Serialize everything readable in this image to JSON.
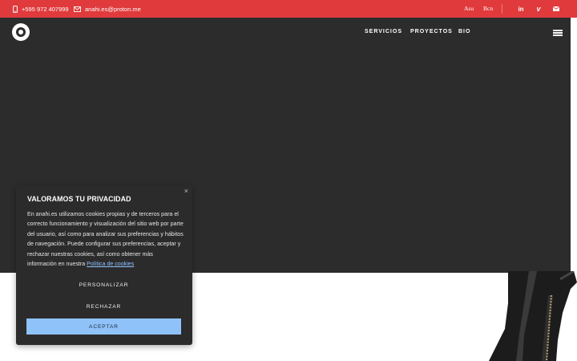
{
  "topbar": {
    "phone": "+595 972 407999",
    "email": "anahi.es@proton.me",
    "lang_1": "Asu",
    "lang_2": "Bcn",
    "social_icons": [
      "linkedin-icon",
      "vimeo-icon",
      "email-icon"
    ]
  },
  "nav": {
    "items": [
      {
        "label": "SERVICIOS"
      },
      {
        "label": "PROYECTOS"
      },
      {
        "label": "BIO"
      }
    ]
  },
  "cookie": {
    "close": "×",
    "title": "VALORAMOS TU PRIVACIDAD",
    "text": "En anahi.es utilizamos cookies propias y de terceros para el correcto funcionamiento y visualización del sitio web por parte del usuario, así como para analizar sus preferencias y hábitos de navegación. Puede configurar sus preferencias, aceptar y rechazar nuestras cookies, así como obtener más información en nuestra ",
    "policy_link": "Política de cookies",
    "customize_label": "PERSONALIZAR",
    "reject_label": "RECHAZAR",
    "accept_label": "ACEPTAR"
  },
  "colors": {
    "topbar": "#e03a3c",
    "hero": "#2c2c2d",
    "cookie_bg": "#2b2b2c",
    "accept_button": "#8fc2f8"
  }
}
